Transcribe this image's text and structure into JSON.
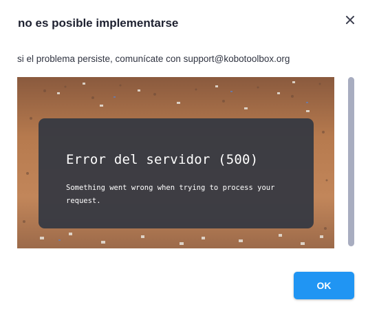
{
  "modal": {
    "title": "no es posible implementarse",
    "close_icon": "close-icon",
    "message": "si el problema persiste, comunícate con support@kobotoolbox.org"
  },
  "error_page": {
    "background": "aerial-photo-settlement",
    "heading": "Error del servidor (500)",
    "detail": "Something went wrong when trying to process your request."
  },
  "scrollbar": {
    "scroll_position": 0
  },
  "footer": {
    "ok_label": "OK"
  },
  "colors": {
    "primary_button": "#2095f3",
    "title_text": "#1e2130",
    "body_text": "#2f3340",
    "error_card": "#343842",
    "scrollbar_thumb": "#a8adc0"
  }
}
